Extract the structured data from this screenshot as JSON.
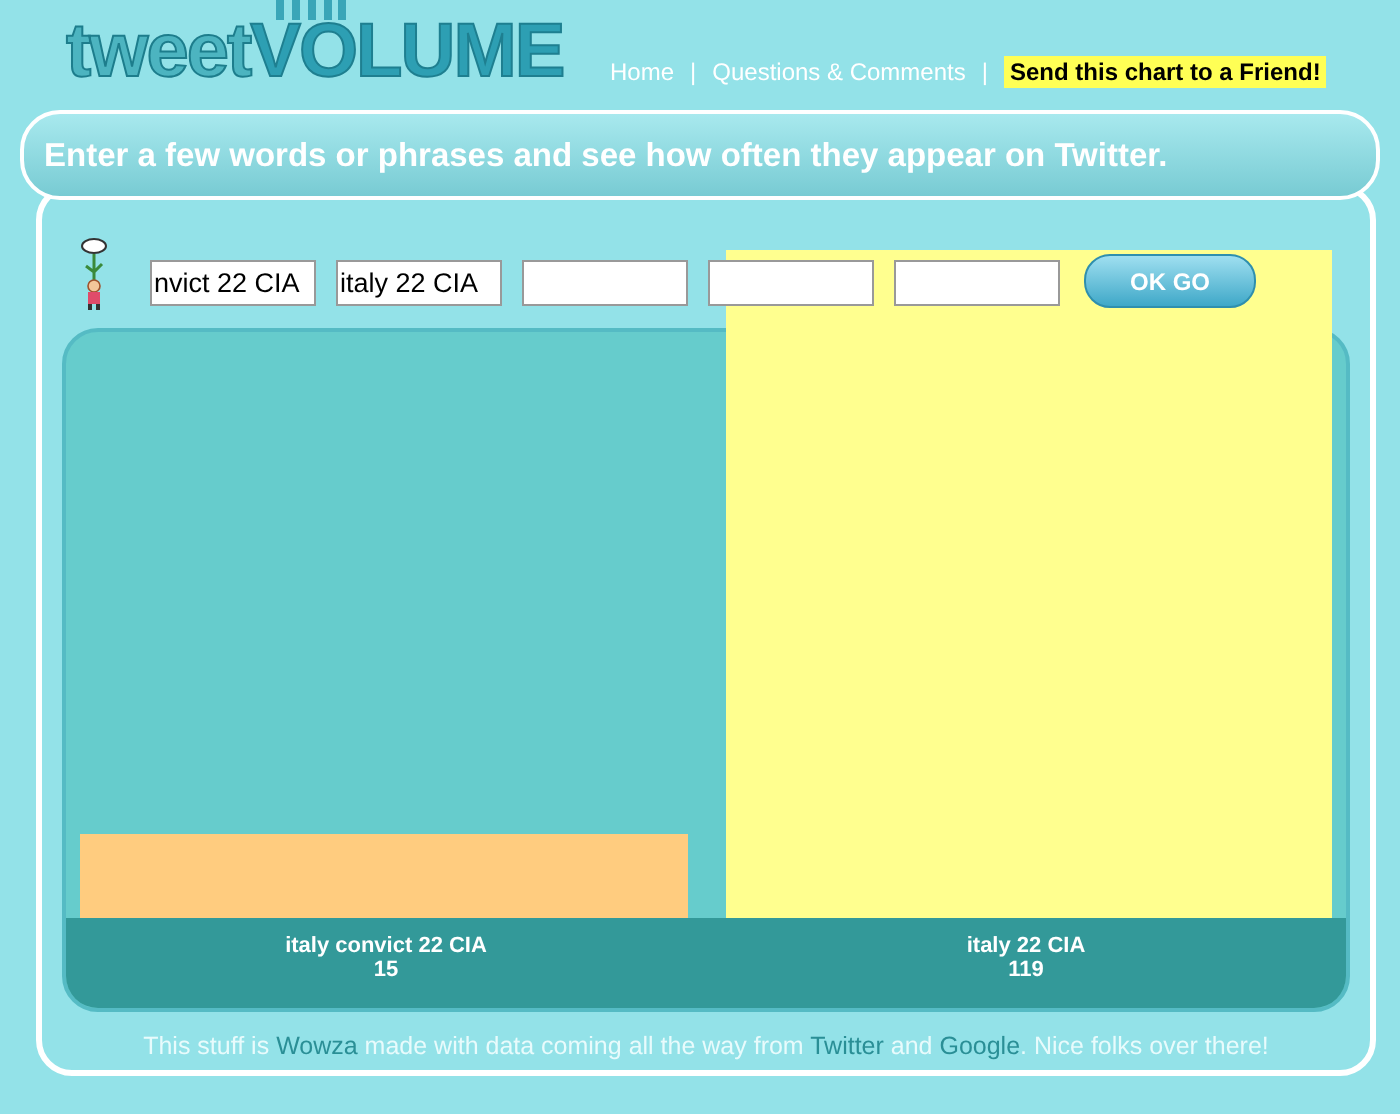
{
  "logo": {
    "part_1": "tweet",
    "part_2": "VOLUME"
  },
  "nav": [
    {
      "label": "Home",
      "kind": "link"
    },
    {
      "label": "|",
      "kind": "separator"
    },
    {
      "label": "Questions & Comments",
      "kind": "link"
    },
    {
      "label": "|",
      "kind": "separator"
    },
    {
      "label": "Send this chart to a Friend!",
      "kind": "highlight"
    }
  ],
  "banner": "Enter a few words or phrases and see how often they appear on Twitter.",
  "inputs": [
    {
      "value": "nvict 22 CIA"
    },
    {
      "value": "italy 22 CIA"
    }
  ],
  "submit": "OK GO",
  "chart": {
    "chart_data": {
      "type": "bar",
      "categories": [
        "italy convict 22 CIA",
        "italy 22 CIA"
      ],
      "values": [
        15,
        119
      ],
      "data_labels": true
    },
    "bars": [
      {
        "count": "15",
        "color": "#ffcc7f"
      },
      {
        "count": "119",
        "color": "#ffff8f"
      }
    ]
  },
  "footer": [
    {
      "text": "This stuff is ",
      "kind": "plain"
    },
    {
      "text": "Wowza",
      "kind": "link"
    },
    {
      "text": " made with data coming all the way from ",
      "kind": "plain"
    },
    {
      "text": "Twitter",
      "kind": "link"
    },
    {
      "text": " and ",
      "kind": "plain"
    },
    {
      "text": "Google",
      "kind": "link"
    },
    {
      "text": ". Nice folks over there!",
      "kind": "plain"
    }
  ]
}
